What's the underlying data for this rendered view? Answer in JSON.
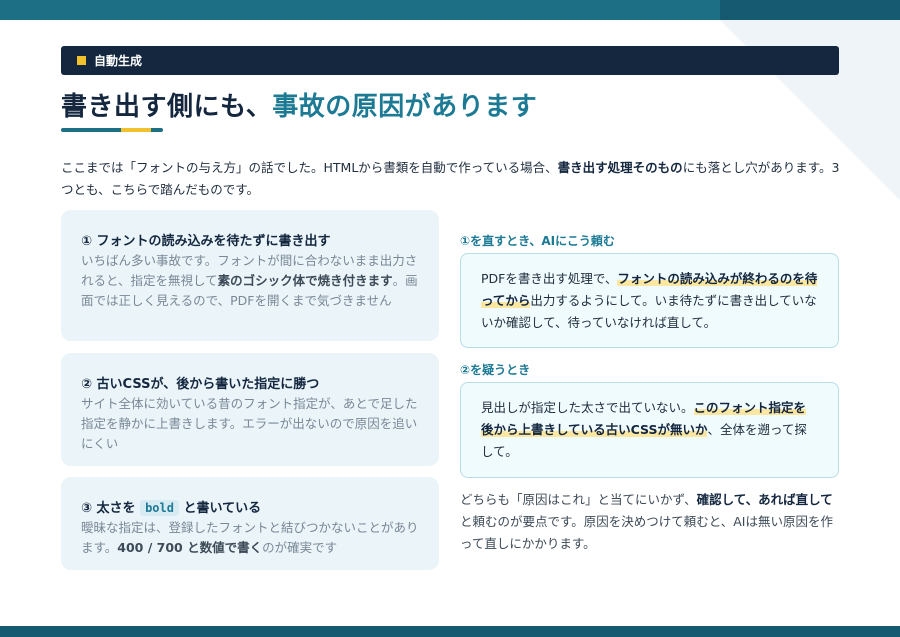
{
  "label": "自動生成",
  "title": {
    "main": "書き出す側にも、",
    "accent": "事故の原因があります"
  },
  "intro": {
    "t1": "ここまでは「フォントの与え方」の話でした。HTMLから書類を自動で作っている場合、",
    "b1": "書き出す処理そのもの",
    "t2": "にも落とし穴があります。3つとも、こちらで踏んだものです。"
  },
  "cards": [
    {
      "title": "① フォントの読み込みを待たずに書き出す",
      "t1": "いちばん多い事故です。フォントが間に合わないまま出力されると、指定を無視して",
      "b1": "素のゴシック体で焼き付きます",
      "t2": "。画面では正しく見えるので、PDFを開くまで気づきません"
    },
    {
      "title": "② 古いCSSが、後から書いた指定に勝つ",
      "t1": "サイト全体に効いている昔のフォント指定が、あとで足した指定を静かに上書きします。エラーが出ないので原因を追いにくい"
    },
    {
      "title_a": "③ 太さを",
      "code": "bold",
      "title_b": "と書いている",
      "t1": "曖昧な指定は、登録したフォントと結びつかないことがあります。",
      "b1": "400 / 700 と数値で書く",
      "t2": "のが確実です"
    }
  ],
  "right": {
    "h1": "①を直すとき、AIにこう頼む",
    "p1": {
      "t1": "PDFを書き出す処理で、",
      "hl": "フォントの読み込みが終わるのを待ってから",
      "t2": "出力するようにして。いま待たずに書き出していないか確認して、待っていなければ直して。"
    },
    "h2": "②を疑うとき",
    "p2": {
      "t1": "見出しが指定した太さで出ていない。",
      "hl": "このフォント指定を後から上書きしている古いCSSが無いか",
      "t2": "、全体を遡って探して。"
    },
    "summary": {
      "t1": "どちらも「原因はこれ」と当てにいかず、",
      "b1": "確認して、あれば直して",
      "t2": "と頼むのが要点です。原因を決めつけて頼むと、AIは無い原因を作って直しにかかります。"
    }
  }
}
